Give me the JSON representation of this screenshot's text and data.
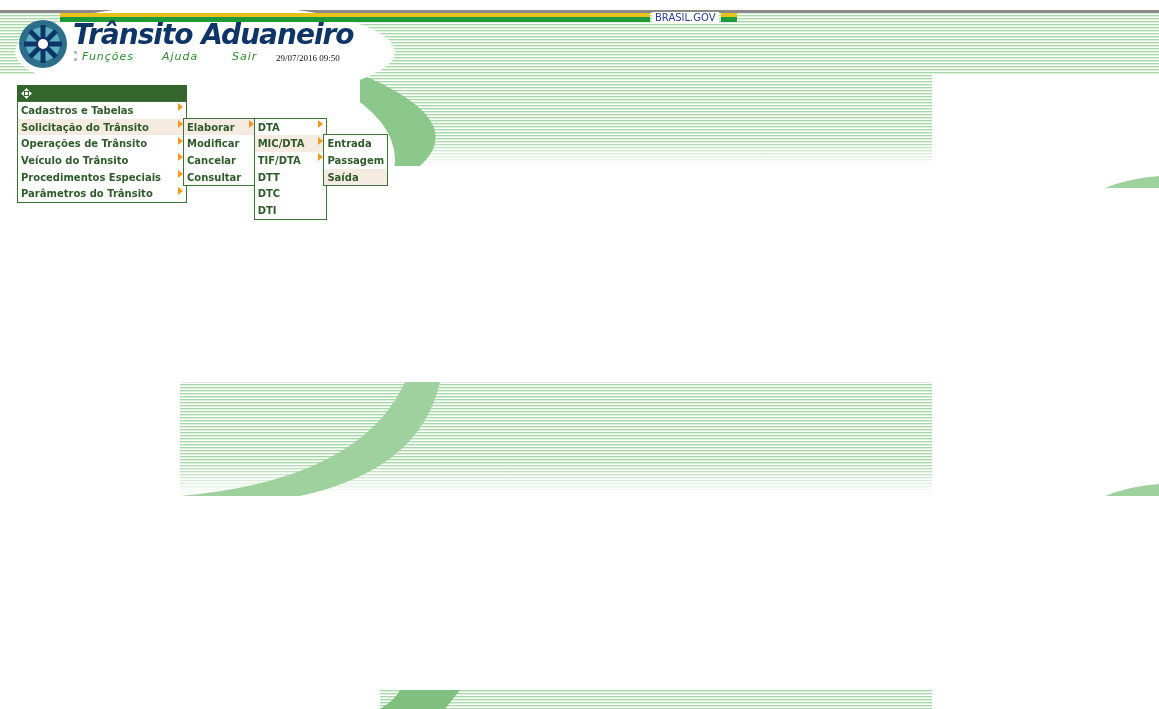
{
  "gov_bar": {
    "label": "BRASIL.GOV"
  },
  "header": {
    "title": "Trânsito Aduaneiro",
    "nav": [
      "Funções",
      "Ajuda",
      "Sair"
    ],
    "datetime": "29/07/2016 09:50"
  },
  "menu": {
    "items": [
      {
        "label": "Cadastros e Tabelas",
        "selected": false,
        "has_submenu": true
      },
      {
        "label": "Solicitação do Trânsito",
        "selected": true,
        "has_submenu": true,
        "children": [
          {
            "label": "Elaborar",
            "selected": true,
            "has_submenu": true,
            "children": [
              {
                "label": "DTA",
                "selected": false,
                "has_submenu": true
              },
              {
                "label": "MIC/DTA",
                "selected": true,
                "has_submenu": true,
                "children": [
                  {
                    "label": "Entrada",
                    "selected": false,
                    "has_submenu": false
                  },
                  {
                    "label": "Passagem",
                    "selected": false,
                    "has_submenu": false
                  },
                  {
                    "label": "Saída",
                    "selected": true,
                    "has_submenu": false
                  }
                ]
              },
              {
                "label": "TIF/DTA",
                "selected": false,
                "has_submenu": true
              },
              {
                "label": "DTT",
                "selected": false,
                "has_submenu": false
              },
              {
                "label": "DTC",
                "selected": false,
                "has_submenu": false
              },
              {
                "label": "DTI",
                "selected": false,
                "has_submenu": false
              }
            ]
          },
          {
            "label": "Modificar",
            "selected": false,
            "has_submenu": false
          },
          {
            "label": "Cancelar",
            "selected": false,
            "has_submenu": false
          },
          {
            "label": "Consultar",
            "selected": false,
            "has_submenu": false
          }
        ]
      },
      {
        "label": "Operações de Trânsito",
        "selected": false,
        "has_submenu": true
      },
      {
        "label": "Veículo do Trânsito",
        "selected": false,
        "has_submenu": true
      },
      {
        "label": "Procedimentos Especiais",
        "selected": false,
        "has_submenu": true
      },
      {
        "label": "Parâmetros do Trânsito",
        "selected": false,
        "has_submenu": true
      }
    ]
  }
}
